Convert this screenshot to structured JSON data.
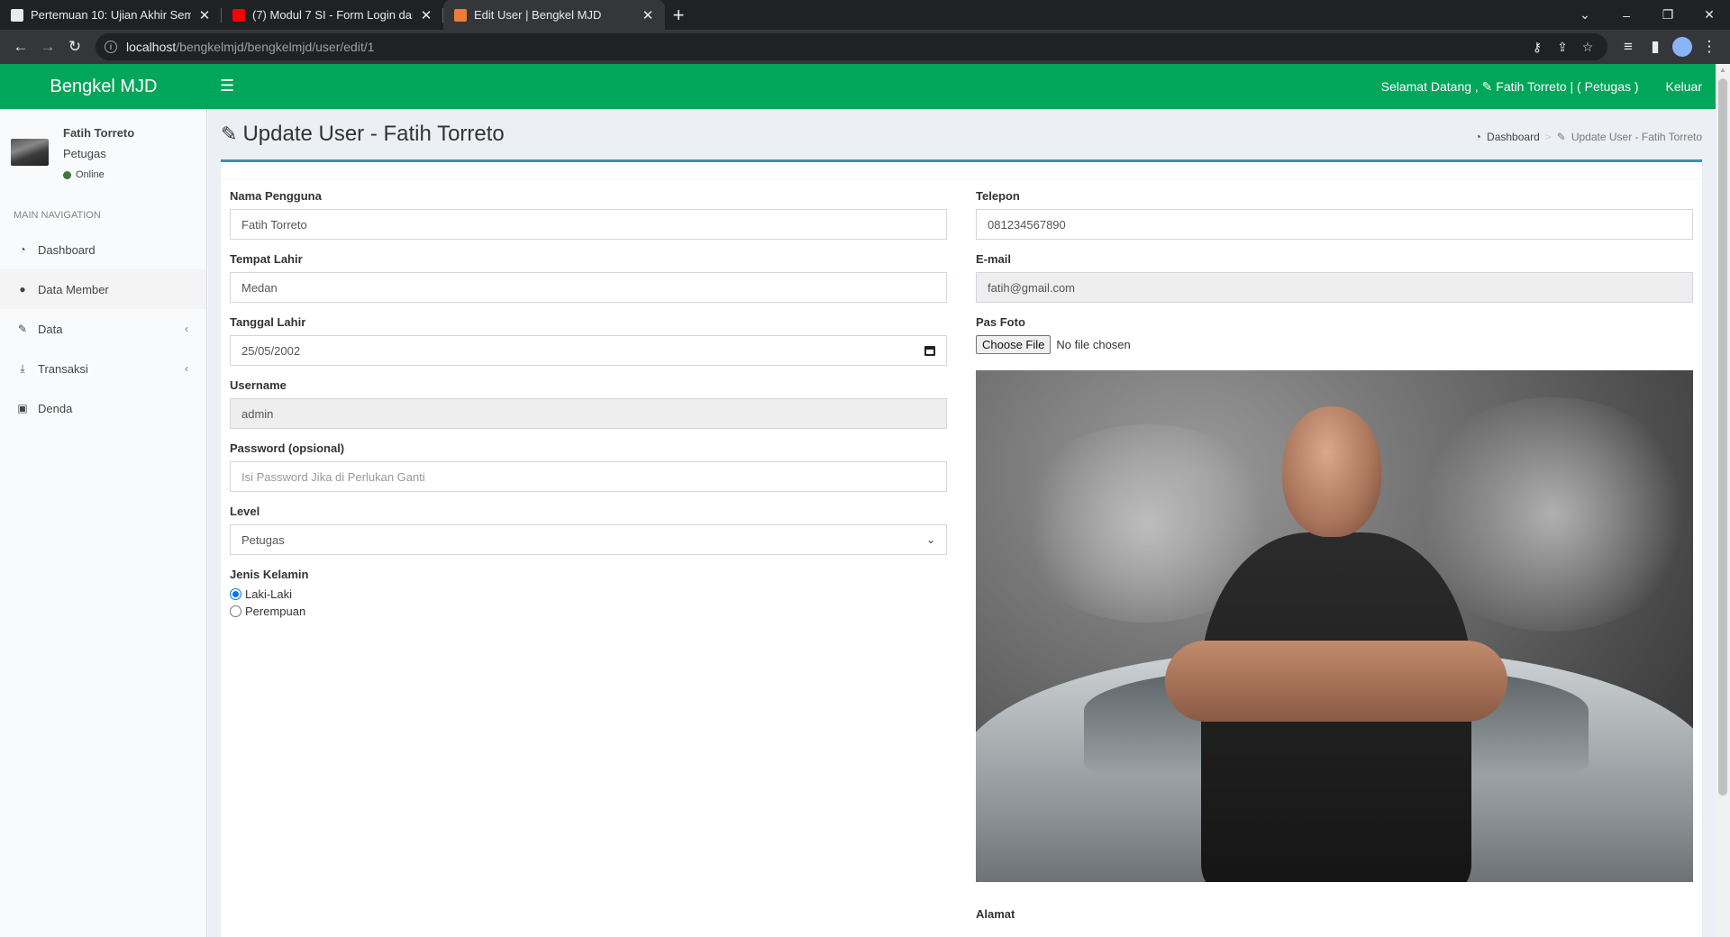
{
  "browser": {
    "tabs": [
      {
        "title": "Pertemuan 10: Ujian Akhir Semester",
        "favicon_color": "#e8eaed",
        "active": false
      },
      {
        "title": "(7) Modul 7 SI - Form Login dan",
        "favicon_color": "#ff0000",
        "active": false
      },
      {
        "title": "Edit User | Bengkel MJD",
        "favicon_color": "#f07c3a",
        "active": true
      }
    ],
    "url_host": "localhost",
    "url_path": "/bengkelmjd/bengkelmjd/user/edit/1"
  },
  "header": {
    "brand": "Bengkel MJD",
    "welcome": "Selamat Datang , ✎ Fatih Torreto | ( Petugas )",
    "logout": "Keluar",
    "color": "#00a65a"
  },
  "sidebar": {
    "user_name": "Fatih Torreto",
    "user_role": "Petugas",
    "status": "Online",
    "nav_header": "MAIN NAVIGATION",
    "items": [
      {
        "label": "Dashboard",
        "icon": "dashboard-icon"
      },
      {
        "label": "Data Member",
        "icon": "user-icon"
      },
      {
        "label": "Data",
        "icon": "edit-icon"
      },
      {
        "label": "Transaksi",
        "icon": "download-icon"
      },
      {
        "label": "Denda",
        "icon": "money-icon"
      }
    ]
  },
  "page": {
    "title": "Update User - Fatih Torreto",
    "breadcrumb_home": "Dashboard",
    "breadcrumb_current": "Update User - Fatih Torreto"
  },
  "form": {
    "nama_label": "Nama Pengguna",
    "nama_value": "Fatih Torreto",
    "tempat_label": "Tempat Lahir",
    "tempat_value": "Medan",
    "tanggal_label": "Tanggal Lahir",
    "tanggal_value": "25/05/2002",
    "username_label": "Username",
    "username_value": "admin",
    "password_label": "Password (opsional)",
    "password_placeholder": "Isi Password Jika di Perlukan Ganti",
    "level_label": "Level",
    "level_value": "Petugas",
    "gender_label": "Jenis Kelamin",
    "gender_options": [
      "Laki-Laki",
      "Perempuan"
    ],
    "gender_selected": "Laki-Laki",
    "telepon_label": "Telepon",
    "telepon_value": "081234567890",
    "email_label": "E-mail",
    "email_value": "fatih@gmail.com",
    "foto_label": "Pas Foto",
    "file_button": "Choose File",
    "file_status": "No file chosen",
    "alamat_label": "Alamat"
  }
}
